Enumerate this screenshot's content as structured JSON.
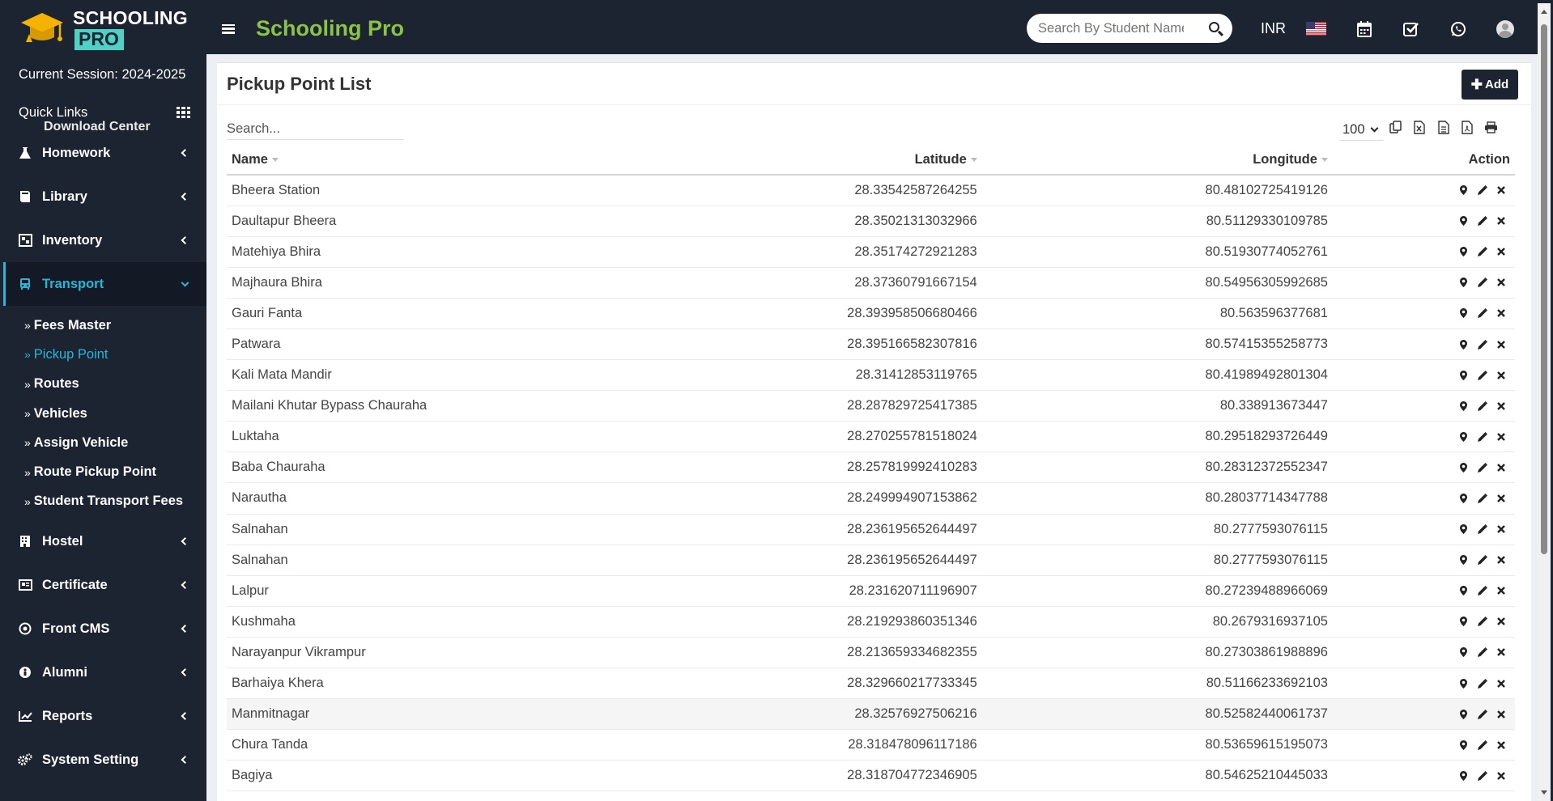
{
  "app": {
    "logo_line1": "SCHOOLING",
    "logo_line2": "PRO",
    "brand": "Schooling Pro"
  },
  "sidebar": {
    "session": "Current Session: 2024-2025",
    "quick_links": "Quick Links",
    "partial_item": "Download Center",
    "menu_before": [
      {
        "label": "Homework",
        "icon": "flask-icon"
      },
      {
        "label": "Library",
        "icon": "book-icon"
      },
      {
        "label": "Inventory",
        "icon": "inventory-icon"
      }
    ],
    "active_menu": {
      "label": "Transport",
      "icon": "bus-icon"
    },
    "submenu": [
      {
        "label": "Fees Master"
      },
      {
        "label": "Pickup Point"
      },
      {
        "label": "Routes"
      },
      {
        "label": "Vehicles"
      },
      {
        "label": "Assign Vehicle"
      },
      {
        "label": "Route Pickup Point"
      },
      {
        "label": "Student Transport Fees"
      }
    ],
    "menu_after": [
      {
        "label": "Hostel",
        "icon": "building-icon"
      },
      {
        "label": "Certificate",
        "icon": "certificate-icon"
      },
      {
        "label": "Front CMS",
        "icon": "cms-icon"
      },
      {
        "label": "Alumni",
        "icon": "alumni-icon"
      },
      {
        "label": "Reports",
        "icon": "chart-icon"
      },
      {
        "label": "System Setting",
        "icon": "gears-icon"
      }
    ]
  },
  "header": {
    "search_placeholder": "Search By Student Name",
    "currency": "INR",
    "icons": [
      "flag-us-icon",
      "calendar-icon",
      "checkbox-icon",
      "whatsapp-icon",
      "user-avatar-icon"
    ]
  },
  "panel": {
    "title": "Pickup Point List",
    "add_label": "Add",
    "search_placeholder": "Search...",
    "page_size": "100",
    "export_icons": [
      "copy-icon",
      "excel-icon",
      "csv-icon",
      "pdf-icon",
      "print-icon"
    ]
  },
  "table": {
    "headers": {
      "name": "Name",
      "latitude": "Latitude",
      "longitude": "Longitude",
      "action": "Action"
    },
    "rows": [
      {
        "name": "Bheera Station",
        "lat": "28.33542587264255",
        "lon": "80.48102725419126"
      },
      {
        "name": "Daultapur Bheera",
        "lat": "28.35021313032966",
        "lon": "80.51129330109785"
      },
      {
        "name": "Matehiya Bhira",
        "lat": "28.35174272921283",
        "lon": "80.51930774052761"
      },
      {
        "name": "Majhaura Bhira",
        "lat": "28.37360791667154",
        "lon": "80.54956305992685"
      },
      {
        "name": "Gauri Fanta",
        "lat": "28.393958506680466",
        "lon": "80.563596377681"
      },
      {
        "name": "Patwara",
        "lat": "28.395166582307816",
        "lon": "80.57415355258773"
      },
      {
        "name": "Kali Mata Mandir",
        "lat": "28.31412853119765",
        "lon": "80.41989492801304"
      },
      {
        "name": "Mailani Khutar Bypass Chauraha",
        "lat": "28.287829725417385",
        "lon": "80.338913673447"
      },
      {
        "name": "Luktaha",
        "lat": "28.270255781518024",
        "lon": "80.29518293726449"
      },
      {
        "name": "Baba Chauraha",
        "lat": "28.257819992410283",
        "lon": "80.28312372552347"
      },
      {
        "name": "Narautha",
        "lat": "28.249994907153862",
        "lon": "80.28037714347788"
      },
      {
        "name": "Salnahan",
        "lat": "28.236195652644497",
        "lon": "80.2777593076115"
      },
      {
        "name": "Salnahan",
        "lat": "28.236195652644497",
        "lon": "80.2777593076115"
      },
      {
        "name": "Lalpur",
        "lat": "28.231620711196907",
        "lon": "80.27239488966069"
      },
      {
        "name": "Kushmaha",
        "lat": "28.219293860351346",
        "lon": "80.2679316937105"
      },
      {
        "name": "Narayanpur Vikrampur",
        "lat": "28.213659334682355",
        "lon": "80.27303861988896"
      },
      {
        "name": "Barhaiya Khera",
        "lat": "28.329660217733345",
        "lon": "80.51166233692103"
      },
      {
        "name": "Manmitnagar",
        "lat": "28.32576927506216",
        "lon": "80.52582440061737"
      },
      {
        "name": "Chura Tanda",
        "lat": "28.318478096117186",
        "lon": "80.53659615195073"
      },
      {
        "name": "Bagiya",
        "lat": "28.318704772346905",
        "lon": "80.54625210445033"
      }
    ]
  }
}
